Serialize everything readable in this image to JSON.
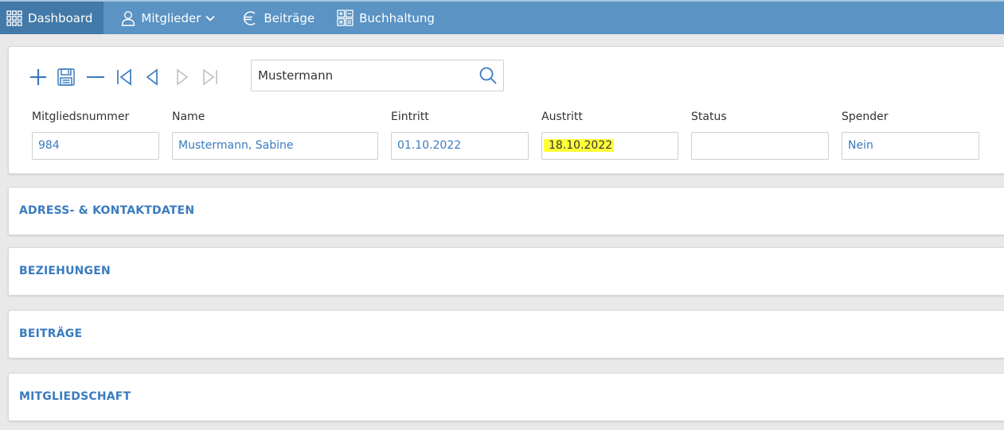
{
  "nav": {
    "items": [
      {
        "label": "Dashboard",
        "icon": "grid-icon"
      },
      {
        "label": "Mitglieder",
        "icon": "person-icon"
      },
      {
        "label": "Beiträge",
        "icon": "euro-icon"
      },
      {
        "label": "Buchhaltung",
        "icon": "calculator-icon"
      }
    ]
  },
  "toolbar": {
    "icons": [
      "plus-icon",
      "save-icon",
      "minus-icon",
      "first-record-icon",
      "previous-record-icon",
      "next-record-icon",
      "last-record-icon"
    ]
  },
  "search": {
    "value": "Mustermann",
    "icon": "search-icon"
  },
  "fields": [
    {
      "label": "Mitgliedsnummer",
      "value": "984"
    },
    {
      "label": "Name",
      "value": "Mustermann, Sabine"
    },
    {
      "label": "Eintritt",
      "value": "01.10.2022"
    },
    {
      "label": "Austritt",
      "value": "18.10.2022"
    },
    {
      "label": "Status",
      "value": ""
    },
    {
      "label": "Spender",
      "value": "Nein"
    }
  ],
  "sections": [
    {
      "title": "ADRESS- & KONTAKTDATEN"
    },
    {
      "title": "BEZIEHUNGEN"
    },
    {
      "title": "BEITRÄGE"
    },
    {
      "title": "MITGLIEDSCHAFT"
    }
  ],
  "colors": {
    "nav_bg": "#5a93c4",
    "nav_active": "#4379a8",
    "accent": "#3a7bbf",
    "highlight": "#ffff3a"
  }
}
